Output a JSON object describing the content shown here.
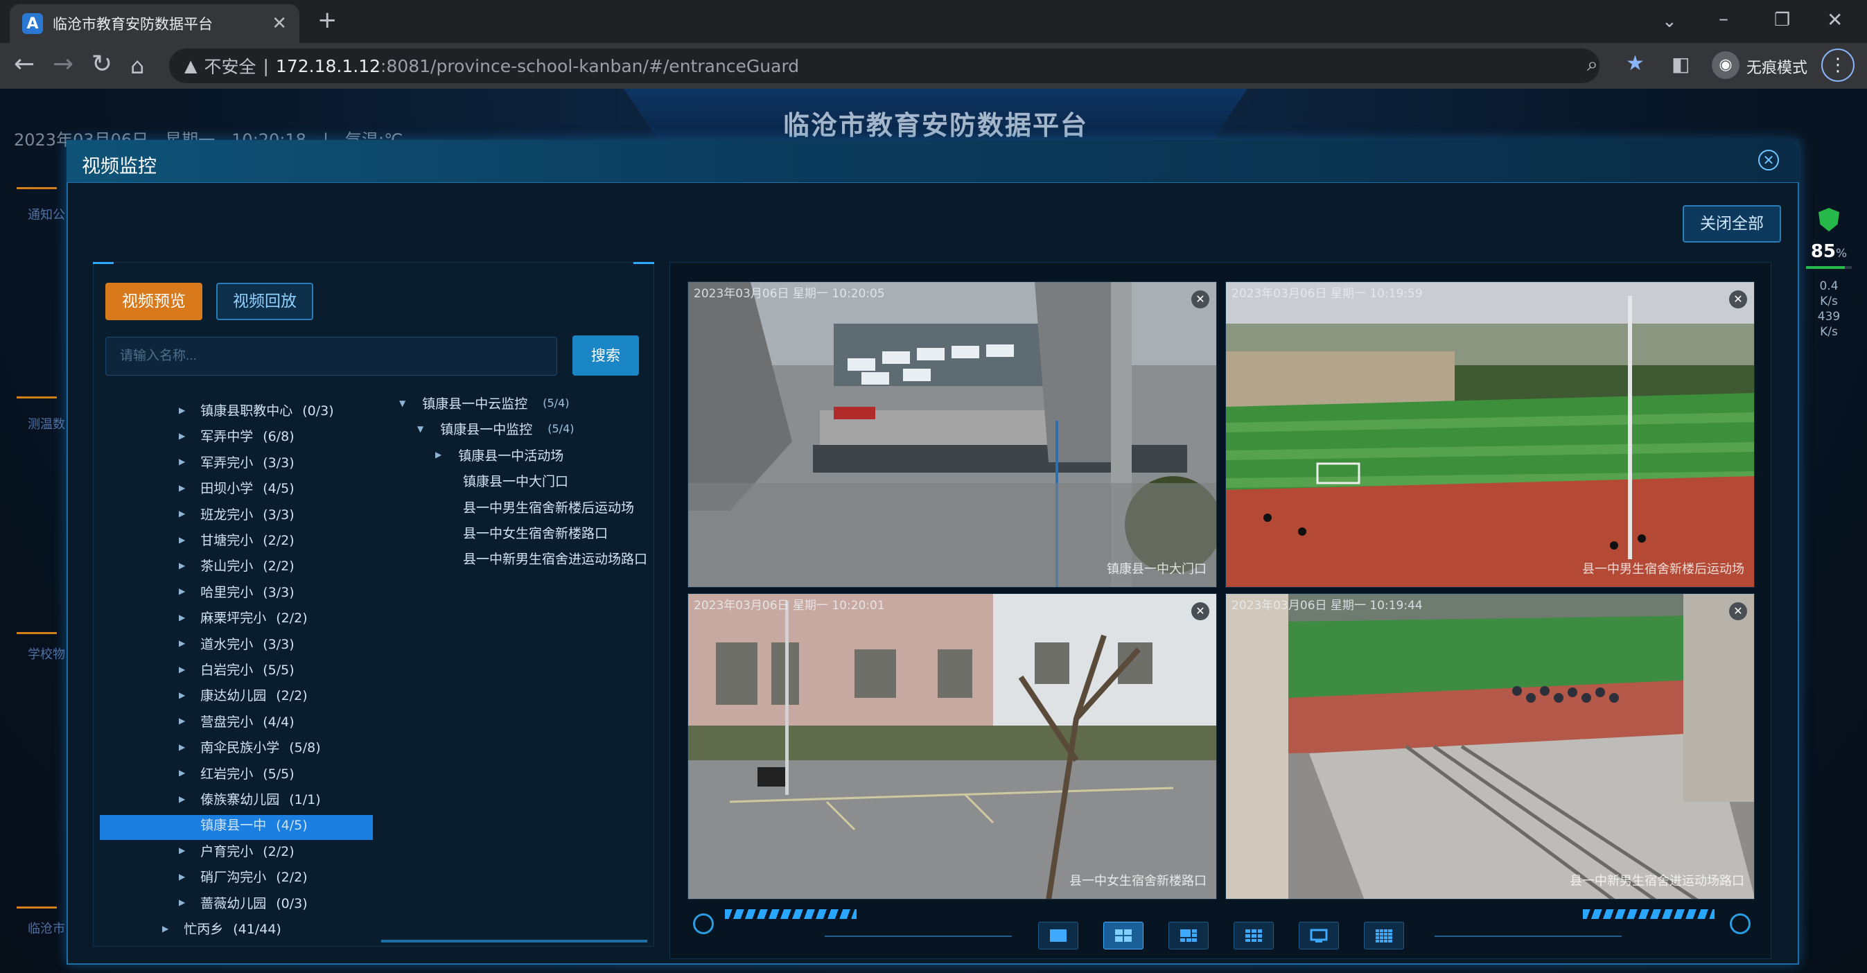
{
  "browser": {
    "tab_title": "临沧市教育安防数据平台",
    "tab_close": "✕",
    "new_tab": "+",
    "address": {
      "security_label": "不安全",
      "host": "172.18.1.12",
      "path": ":8081/province-school-kanban/#/entranceGuard"
    },
    "profile_label": "无痕模式"
  },
  "page": {
    "title": "临沧市教育安防数据平台",
    "datetime": "2023年03月06日　星期一　10:20:18　|　气温:℃",
    "side_fragments": [
      "通知公",
      "测温数",
      "学校物",
      "临沧市"
    ],
    "stats": {
      "percent": "85",
      "percent_unit": "%",
      "rate1": "0.4",
      "rate1_unit": "K/s",
      "rate2": "439",
      "rate2_unit": "K/s"
    }
  },
  "modal": {
    "title": "视频监控",
    "close_all": "关闭全部",
    "tabs": {
      "preview": "视频预览",
      "playback": "视频回放"
    },
    "search": {
      "placeholder": "请输入名称...",
      "button": "搜索"
    },
    "tree_left": [
      {
        "label": "镇康县职教中心",
        "count": "(0/3)"
      },
      {
        "label": "军弄中学",
        "count": "(6/8)"
      },
      {
        "label": "军弄完小",
        "count": "(3/3)"
      },
      {
        "label": "田坝小学",
        "count": "(4/5)"
      },
      {
        "label": "班龙完小",
        "count": "(3/3)"
      },
      {
        "label": "甘塘完小",
        "count": "(2/2)"
      },
      {
        "label": "茶山完小",
        "count": "(2/2)"
      },
      {
        "label": "哈里完小",
        "count": "(3/3)"
      },
      {
        "label": "麻栗坪完小",
        "count": "(2/2)"
      },
      {
        "label": "道水完小",
        "count": "(3/3)"
      },
      {
        "label": "白岩完小",
        "count": "(5/5)"
      },
      {
        "label": "康达幼儿园",
        "count": "(2/2)"
      },
      {
        "label": "营盘完小",
        "count": "(4/4)"
      },
      {
        "label": "南伞民族小学",
        "count": "(5/8)"
      },
      {
        "label": "红岩完小",
        "count": "(5/5)"
      },
      {
        "label": "傣族寨幼儿园",
        "count": "(1/1)"
      },
      {
        "label": "镇康县一中",
        "count": "(4/5)"
      },
      {
        "label": "户育完小",
        "count": "(2/2)"
      },
      {
        "label": "硝厂沟完小",
        "count": "(2/2)"
      },
      {
        "label": "蔷薇幼儿园",
        "count": "(0/3)"
      },
      {
        "label": "忙丙乡",
        "count": "(41/44)"
      }
    ],
    "tree_right": [
      {
        "label": "镇康县一中云监控",
        "count": "(5/4)"
      },
      {
        "label": "镇康县一中监控",
        "count": "(5/4)"
      },
      {
        "label": "镇康县一中活动场",
        "count": ""
      },
      {
        "label": "镇康县一中大门口",
        "count": ""
      },
      {
        "label": "县一中男生宿舍新楼后运动场",
        "count": ""
      },
      {
        "label": "县一中女生宿舍新楼路口",
        "count": ""
      },
      {
        "label": "县一中新男生宿舍进运动场路口",
        "count": ""
      }
    ],
    "videos": [
      {
        "timestamp": "2023年03月06日 星期一 10:20:05",
        "camera": "镇康县一中大门口"
      },
      {
        "timestamp": "2023年03月06日 星期一 10:19:59",
        "camera": "县一中男生宿舍新楼后运动场"
      },
      {
        "timestamp": "2023年03月06日 星期一 10:20:01",
        "camera": "县一中女生宿舍新楼路口"
      },
      {
        "timestamp": "2023年03月06日 星期一 10:19:44",
        "camera": "县一中新男生宿舍进运动场路口"
      }
    ],
    "selected_layout": "4-grid"
  },
  "colors": {
    "accent": "#1b86c6",
    "orange": "#d87a1c",
    "selected": "#1a7fe0"
  }
}
